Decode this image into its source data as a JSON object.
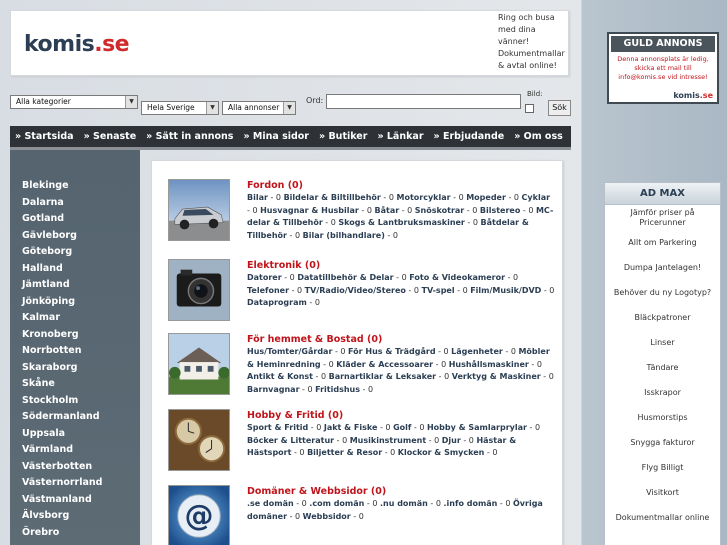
{
  "header": {
    "logo_main": "komis",
    "logo_suffix": ".se",
    "promo": "Ring och busa med dina vänner! Dokumentmallar & avtal online!"
  },
  "search": {
    "category": "Alla kategorier",
    "region": "Hela Sverige",
    "ad_type": "Alla annonser",
    "ord_label": "Ord:",
    "bild_label": "Bild:",
    "button": "Sök",
    "query": ""
  },
  "nav": [
    "» Startsida",
    "» Senaste",
    "» Sätt in annons",
    "» Mina sidor",
    "» Butiker",
    "» Länkar",
    "» Erbjudande",
    "» Om oss"
  ],
  "regions": [
    "Blekinge",
    "Dalarna",
    "Gotland",
    "Gävleborg",
    "Göteborg",
    "Halland",
    "Jämtland",
    "Jönköping",
    "Kalmar",
    "Kronoberg",
    "Norrbotten",
    "Skaraborg",
    "Skåne",
    "Stockholm",
    "Södermanland",
    "Uppsala",
    "Värmland",
    "Västerbotten",
    "Västernorrland",
    "Västmanland",
    "Älvsborg",
    "Örebro"
  ],
  "categories": [
    {
      "title": "Fordon (0)",
      "links": [
        [
          "Bilar",
          "0"
        ],
        [
          "Bildelar & Biltillbehör",
          "0"
        ],
        [
          "Motorcyklar",
          "0"
        ],
        [
          "Mopeder",
          "0"
        ],
        [
          "Cyklar",
          "0"
        ],
        [
          "Husvagnar & Husbilar",
          "0"
        ],
        [
          "Båtar",
          "0"
        ],
        [
          "Snöskotrar",
          "0"
        ],
        [
          "Bilstereo",
          "0"
        ],
        [
          "MC-delar & Tillbehör",
          "0"
        ],
        [
          "Skogs & Lantbruksmaskiner",
          "0"
        ],
        [
          "Båtdelar & Tillbehör",
          "0"
        ],
        [
          "Bilar (bilhandlare)",
          "0"
        ]
      ]
    },
    {
      "title": "Elektronik (0)",
      "links": [
        [
          "Datorer",
          "0"
        ],
        [
          "Datatillbehör & Delar",
          "0"
        ],
        [
          "Foto & Videokameror",
          "0"
        ],
        [
          "Telefoner",
          "0"
        ],
        [
          "TV/Radio/Video/Stereo",
          "0"
        ],
        [
          "TV-spel",
          "0"
        ],
        [
          "Film/Musik/DVD",
          "0"
        ],
        [
          "Dataprogram",
          "0"
        ]
      ]
    },
    {
      "title": "För hemmet & Bostad (0)",
      "links": [
        [
          "Hus/Tomter/Gårdar",
          "0"
        ],
        [
          "För Hus & Trädgård",
          "0"
        ],
        [
          "Lägenheter",
          "0"
        ],
        [
          "Möbler & Heminredning",
          "0"
        ],
        [
          "Kläder & Accessoarer",
          "0"
        ],
        [
          "Hushållsmaskiner",
          "0"
        ],
        [
          "Antikt & Konst",
          "0"
        ],
        [
          "Barnartiklar & Leksaker",
          "0"
        ],
        [
          "Verktyg & Maskiner",
          "0"
        ],
        [
          "Barnvagnar",
          "0"
        ],
        [
          "Fritidshus",
          "0"
        ]
      ]
    },
    {
      "title": "Hobby & Fritid (0)",
      "links": [
        [
          "Sport & Fritid",
          "0"
        ],
        [
          "Jakt & Fiske",
          "0"
        ],
        [
          "Golf",
          "0"
        ],
        [
          "Hobby & Samlarprylar",
          "0"
        ],
        [
          "Böcker & Litteratur",
          "0"
        ],
        [
          "Musikinstrument",
          "0"
        ],
        [
          "Djur",
          "0"
        ],
        [
          "Hästar & Hästsport",
          "0"
        ],
        [
          "Biljetter & Resor",
          "0"
        ],
        [
          "Klockor & Smycken",
          "0"
        ]
      ]
    },
    {
      "title": "Domäner & Webbsidor (0)",
      "links": [
        [
          ".se domän",
          "0"
        ],
        [
          ".com domän",
          "0"
        ],
        [
          ".nu domän",
          "0"
        ],
        [
          ".info domän",
          "0"
        ],
        [
          "Övriga domäner",
          "0"
        ],
        [
          "Webbsidor",
          "0"
        ]
      ]
    }
  ],
  "guld": {
    "title": "GULD ANNONS",
    "text": "Denna annonsplats är ledig, skicka ett mail till info@komis.se vid intresse!",
    "logo_main": "komis",
    "logo_suffix": ".se"
  },
  "admax": {
    "title": "AD MAX",
    "items": [
      "Jämför priser på Pricerunner",
      "Allt om Parkering",
      "Dumpa Jantelagen!",
      "Behöver du ny Logotyp?",
      "Bläckpatroner",
      "Linser",
      "Tändare",
      "Isskrapor",
      "Husmorstips",
      "Snygga fakturor",
      "Flyg Billigt",
      "Visitkort",
      "Dokumentmallar online"
    ]
  },
  "colors": {
    "accent_red": "#c0141b",
    "nav_bg": "#2e3236",
    "sidebar_bg": "#55646f",
    "brand_dark": "#2b3e53"
  }
}
